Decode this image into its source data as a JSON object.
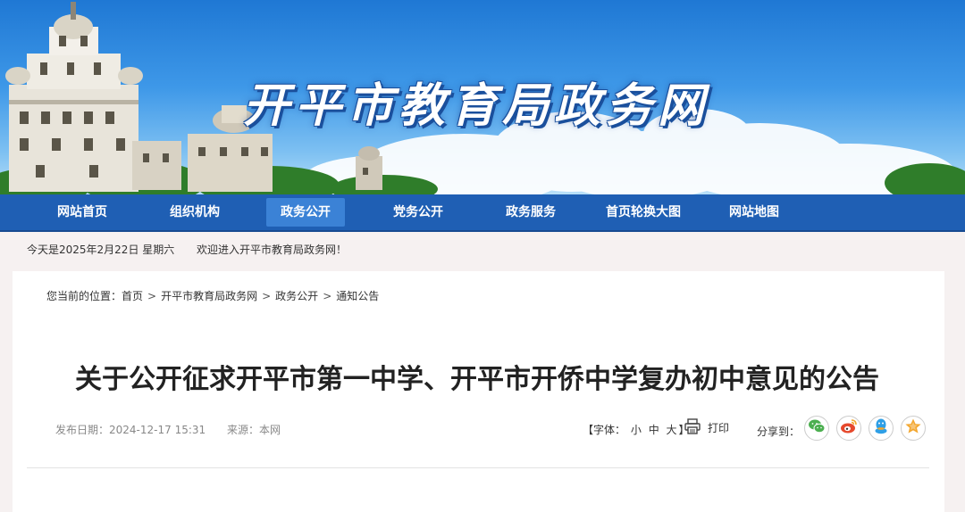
{
  "banner": {
    "title": "开平市教育局政务网"
  },
  "nav": {
    "items": [
      {
        "label": "网站首页"
      },
      {
        "label": "组织机构"
      },
      {
        "label": "政务公开"
      },
      {
        "label": "党务公开"
      },
      {
        "label": "政务服务"
      },
      {
        "label": "首页轮换大图"
      },
      {
        "label": "网站地图"
      }
    ],
    "active": "政务公开"
  },
  "infobar": {
    "date": "今天是2025年2月22日  星期六",
    "welcome": "欢迎进入开平市教育局政务网！"
  },
  "breadcrumb": {
    "prefix": "您当前的位置：",
    "items": [
      "首页",
      "开平市教育局政务网",
      "政务公开",
      "通知公告"
    ],
    "separator": ">"
  },
  "article": {
    "title": "关于公开征求开平市第一中学、开平市开侨中学复办初中意见的公告",
    "publish_label": "发布日期：",
    "publish_date": "2024-12-17 15:31",
    "source_label": "来源：",
    "source": "本网"
  },
  "tools": {
    "font_prefix": "【字体：",
    "font_small": "小",
    "font_medium": "中",
    "font_large": "大",
    "font_suffix": "】",
    "print_label": "打印",
    "share_label": "分享到：",
    "share_icons": [
      "wechat-icon",
      "weibo-icon",
      "qq-icon",
      "qzone-icon"
    ]
  },
  "colors": {
    "nav_bg": "#1f5fb4",
    "nav_active": "#3b82d6",
    "wechat": "#4caf50",
    "weibo": "#e6492d",
    "qq": "#2e9fe6",
    "qzone": "#f3a730"
  }
}
